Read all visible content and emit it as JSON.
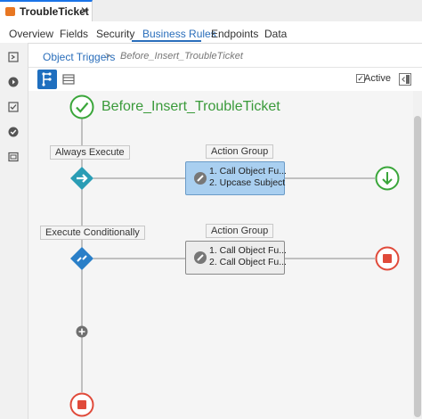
{
  "editor_tab": {
    "title": "TroubleTicket",
    "close": "✕"
  },
  "subtabs": [
    {
      "label": "Overview"
    },
    {
      "label": "Fields"
    },
    {
      "label": "Security"
    },
    {
      "label": "Business Rules"
    },
    {
      "label": "Endpoints"
    },
    {
      "label": "Data"
    }
  ],
  "breadcrumb": {
    "link": "Object Triggers",
    "separator": ">",
    "current": "Before_Insert_TroubleTicket"
  },
  "toolbar": {
    "active_label": "Active",
    "active_checked": true
  },
  "flow": {
    "trigger_name": "Before_Insert_TroubleTicket",
    "branches": [
      {
        "condition_label": "Always Execute",
        "group_header": "Action Group",
        "actions": [
          "1. Call Object Fu...",
          "2. Upcase Subject"
        ],
        "selected": true,
        "end": "continue"
      },
      {
        "condition_label": "Execute Conditionally",
        "group_header": "Action Group",
        "actions": [
          "1. Call Object Fu...",
          "2. Call Object Fu..."
        ],
        "selected": false,
        "end": "stop"
      }
    ]
  },
  "colors": {
    "accent": "#2a6ebb",
    "success": "#3aa63a",
    "stop": "#e04a3a",
    "diamond": "#2a9db5",
    "selected_fill": "#a9cff0"
  }
}
